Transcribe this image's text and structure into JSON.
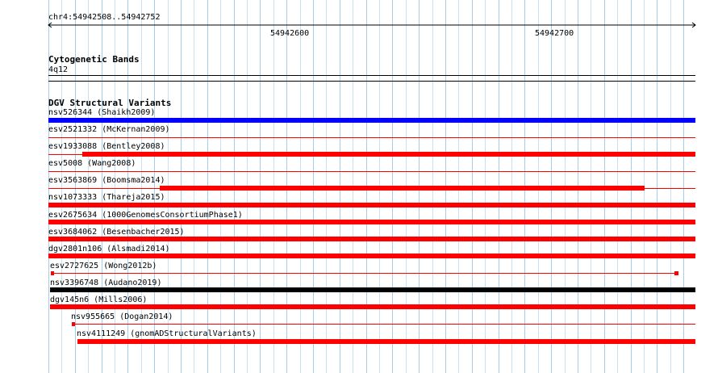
{
  "ruler": {
    "location": "chr4:54942508..54942752",
    "ticks": [
      "54942600",
      "54942700"
    ]
  },
  "cytoband": {
    "title": "Cytogenetic Bands",
    "band": "4q12"
  },
  "dgv": {
    "title": "DGV Structural Variants",
    "colors": {
      "loss": "#ff0000",
      "gain": "#0000ff",
      "complex": "#000000"
    },
    "features": [
      {
        "label": "nsv526344 (Shaikh2009)",
        "color": "#0000ff"
      },
      {
        "label": "esv2521332 (McKernan2009)",
        "color": "#ff0000"
      },
      {
        "label": "esv1933088 (Bentley2008)",
        "color": "#ff0000"
      },
      {
        "label": "esv5008 (Wang2008)",
        "color": "#ff0000"
      },
      {
        "label": "esv3563869 (Boomsma2014)",
        "color": "#ff0000"
      },
      {
        "label": "nsv1073333 (Thareja2015)",
        "color": "#ff0000"
      },
      {
        "label": "esv2675634 (1000GenomesConsortiumPhase1)",
        "color": "#ff0000"
      },
      {
        "label": "esv3684062 (Besenbacher2015)",
        "color": "#ff0000"
      },
      {
        "label": "dgv2801n106 (Alsmadi2014)",
        "color": "#ff0000"
      },
      {
        "label": "esv2727625 (Wong2012b)",
        "color": "#ff0000"
      },
      {
        "label": "nsv3396748 (Audano2019)",
        "color": "#000000"
      },
      {
        "label": "dgv145n6 (Mills2006)",
        "color": "#ff0000"
      },
      {
        "label": "nsv955665 (Dogan2014)",
        "color": "#ff0000"
      },
      {
        "label": "nsv4111249 (gnomADStructuralVariants)",
        "color": "#ff0000"
      }
    ]
  }
}
